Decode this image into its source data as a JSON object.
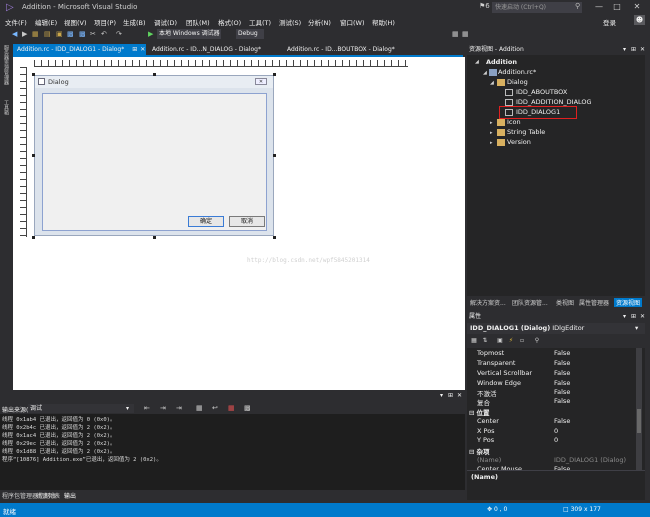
{
  "window": {
    "title": "Addition - Microsoft Visual Studio",
    "notification_count": "6",
    "quick_launch_placeholder": "快速启动 (Ctrl+Q)",
    "sign_in": "登录"
  },
  "menu": [
    "文件(F)",
    "编辑(E)",
    "视图(V)",
    "项目(P)",
    "生成(B)",
    "调试(D)",
    "团队(M)",
    "格式(O)",
    "工具(T)",
    "测试(S)",
    "分析(N)",
    "窗口(W)",
    "帮助(H)"
  ],
  "toolbar": {
    "debugger_target": "本地 Windows 调试器",
    "config": "Debug"
  },
  "left_strip": {
    "server_explorer": "服务器资源管理器",
    "toolbox": "工具箱"
  },
  "doc_tabs": [
    {
      "label": "Addition.rc - IDD_DIALOG1 - Dialog*",
      "active": true
    },
    {
      "label": "Addition.rc - ID...N_DIALOG - Dialog*",
      "active": false
    },
    {
      "label": "Addition.rc - ID...BOUTBOX - Dialog*",
      "active": false
    }
  ],
  "dialog": {
    "title": "Dialog",
    "ok_label": "确定",
    "cancel_label": "取消"
  },
  "watermark": "http://blog.csdn.net/wpf5845201314",
  "resource_view": {
    "header": "资源视图 - Addition",
    "tree": {
      "root": "Addition",
      "rc": "Addition.rc*",
      "dialog_folder": "Dialog",
      "dialogs": [
        "IDD_ABOUTBOX",
        "IDD_ADDITION_DIALOG",
        "IDD_DIALOG1"
      ],
      "folders": [
        "Icon",
        "String Table",
        "Version"
      ]
    },
    "tabs": [
      "解决方案资...",
      "团队资源管...",
      "类视图",
      "属性管理器",
      "资源视图"
    ],
    "active_tab": "资源视图"
  },
  "properties": {
    "header": "属性",
    "object": "IDD_DIALOG1 (Dialog)",
    "object_type": "IDlgEditor",
    "rows": [
      {
        "name": "Topmost",
        "value": "False"
      },
      {
        "name": "Transparent",
        "value": "False"
      },
      {
        "name": "Vertical Scrollbar",
        "value": "False"
      },
      {
        "name": "Window Edge",
        "value": "False"
      },
      {
        "name": "不激活",
        "value": "False"
      },
      {
        "name": "复合",
        "value": "False"
      }
    ],
    "category_position": "位置",
    "position_rows": [
      {
        "name": "Center",
        "value": "False"
      },
      {
        "name": "X Pos",
        "value": "0"
      },
      {
        "name": "Y Pos",
        "value": "0"
      }
    ],
    "category_misc": "杂项",
    "misc_rows": [
      {
        "name": "(Name)",
        "value": "IDD_DIALOG1 (Dialog)"
      },
      {
        "name": "Center Mouse",
        "value": "False"
      }
    ],
    "description": "(Name)"
  },
  "output": {
    "source_label": "输出来源(S):",
    "source_value": "调试",
    "lines": [
      "线程 0x1ab4 已退出，返回值为 0 (0x0)。",
      "线程 0x2b4c 已退出，返回值为 2 (0x2)。",
      "线程 0x1ac4 已退出，返回值为 2 (0x2)。",
      "线程 0x29ec 已退出，返回值为 2 (0x2)。",
      "线程 0x1d88 已退出，返回值为 2 (0x2)。",
      "程序“[10876] Addition.exe”已退出，返回值为 2 (0x2)。"
    ],
    "tabs": [
      "程序包管理器控制台",
      "错误列表",
      "输出"
    ],
    "active_tab": "输出"
  },
  "status": {
    "text": "就绪",
    "position": "0 , 0",
    "size": "309 x 177"
  },
  "colors": {
    "accent": "#007acc",
    "highlight_box": "#e02020"
  }
}
